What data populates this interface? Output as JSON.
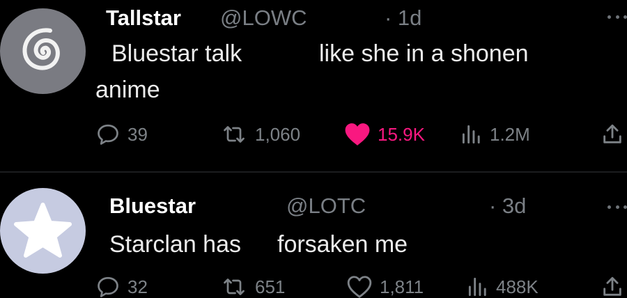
{
  "tweets": [
    {
      "name": "Tallstar",
      "handle": "@LOWC",
      "time": "· 1d",
      "text_line1a": "Bluestar talk",
      "text_line1b": "like she in a shonen",
      "text_line2": "anime",
      "avatar_icon": "spiral-icon",
      "replies": "39",
      "reposts": "1,060",
      "likes": "15.9K",
      "liked": true,
      "views": "1.2M"
    },
    {
      "name": "Bluestar",
      "handle": "@LOTC",
      "time": "· 3d",
      "text_line1a": "Starclan has",
      "text_line1b": "forsaken me",
      "avatar_icon": "star-icon",
      "replies": "32",
      "reposts": "651",
      "likes": "1,811",
      "liked": false,
      "views": "488K"
    }
  ],
  "colors": {
    "background": "#000000",
    "like_active": "#f91880",
    "muted": "#7d8287"
  }
}
